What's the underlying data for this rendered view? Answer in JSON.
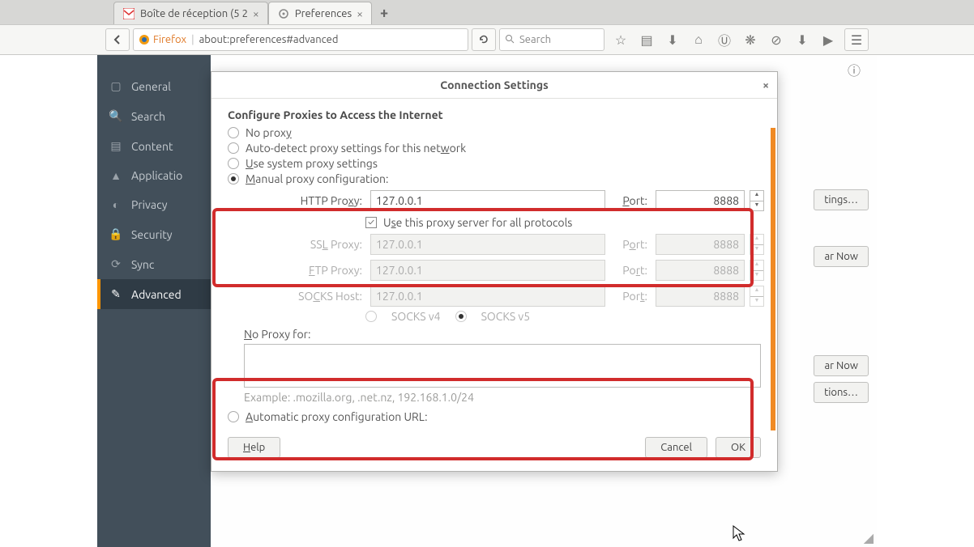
{
  "tabs": {
    "t0": {
      "label": "Boîte de réception (5 2"
    },
    "t1": {
      "label": "Preferences"
    }
  },
  "urlbar": {
    "firefox": "Firefox",
    "url": "about:preferences#advanced"
  },
  "searchbar": {
    "placeholder": "Search"
  },
  "sidebar": {
    "items": {
      "general": {
        "label": "General"
      },
      "search": {
        "label": "Search"
      },
      "content": {
        "label": "Content"
      },
      "applications": {
        "label": "Applicatio"
      },
      "privacy": {
        "label": "Privacy"
      },
      "security": {
        "label": "Security"
      },
      "sync": {
        "label": "Sync"
      },
      "advanced": {
        "label": "Advanced"
      }
    }
  },
  "bg_buttons": {
    "settings": "tings…",
    "clear_now": "ar Now",
    "clear_now2": "ar Now",
    "exceptions": "tions…"
  },
  "dialog": {
    "title": "Connection Settings",
    "heading": "Configure Proxies to Access the Internet",
    "radios": {
      "no_proxy": "No proxy",
      "auto_detect": "Auto-detect proxy settings for this network",
      "use_system": "Use system proxy settings",
      "manual": "Manual proxy configuration:",
      "auto_url": "Automatic proxy configuration URL:"
    },
    "fields": {
      "http_label": "HTTP Proxy:",
      "ssl_label": "SSL Proxy:",
      "ftp_label": "FTP Proxy:",
      "socks_label": "SOCKS Host:",
      "port_label": "Port:",
      "http_host": "127.0.0.1",
      "http_port": "8888",
      "ssl_host": "127.0.0.1",
      "ssl_port": "8888",
      "ftp_host": "127.0.0.1",
      "ftp_port": "8888",
      "socks_host": "127.0.0.1",
      "socks_port": "8888"
    },
    "use_all": "Use this proxy server for all protocols",
    "socks_v4": "SOCKS v4",
    "socks_v5": "SOCKS v5",
    "no_proxy_for": "No Proxy for:",
    "example": "Example: .mozilla.org, .net.nz, 192.168.1.0/24",
    "buttons": {
      "help": "Help",
      "cancel": "Cancel",
      "ok": "OK"
    }
  }
}
